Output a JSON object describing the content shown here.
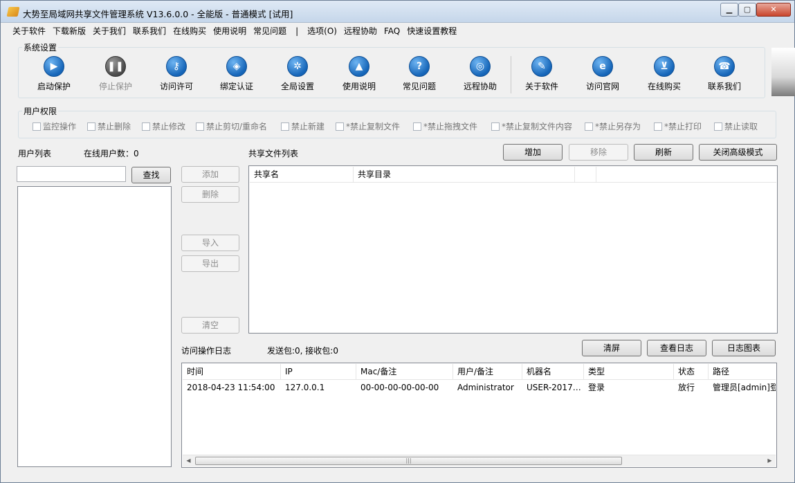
{
  "window": {
    "title": "大势至局域网共享文件管理系统 V13.6.0.0 - 全能版 - 普通模式 [试用]"
  },
  "menu": [
    "关于软件",
    "下载新版",
    "关于我们",
    "联系我们",
    "在线购买",
    "使用说明",
    "常见问题",
    "|",
    "选项(O)",
    "远程协助",
    "FAQ",
    "快速设置教程"
  ],
  "system_settings": {
    "label": "系统设置",
    "tools": [
      {
        "label": "启动保护",
        "icon": "play-icon",
        "enabled": true
      },
      {
        "label": "停止保护",
        "icon": "pause-icon",
        "enabled": false
      },
      {
        "label": "访问许可",
        "icon": "key-icon",
        "enabled": true
      },
      {
        "label": "绑定认证",
        "icon": "shield-icon",
        "enabled": true
      },
      {
        "label": "全局设置",
        "icon": "gear-icon",
        "enabled": true
      },
      {
        "label": "使用说明",
        "icon": "graduation-cap-icon",
        "enabled": true
      },
      {
        "label": "常见问题",
        "icon": "question-icon",
        "enabled": true
      },
      {
        "label": "远程协助",
        "icon": "globe-hand-icon",
        "enabled": true
      },
      {
        "label": "关于软件",
        "icon": "document-pen-icon",
        "enabled": true
      },
      {
        "label": "访问官网",
        "icon": "browser-icon",
        "enabled": true
      },
      {
        "label": "在线购买",
        "icon": "cart-icon",
        "enabled": true
      },
      {
        "label": "联系我们",
        "icon": "phone-icon",
        "enabled": true
      }
    ]
  },
  "permissions": {
    "label": "用户权限",
    "items": [
      "监控操作",
      "禁止删除",
      "禁止修改",
      "禁止剪切/重命名",
      "禁止新建",
      "*禁止复制文件",
      "*禁止拖拽文件",
      "*禁止复制文件内容",
      "*禁止另存为",
      "*禁止打印",
      "禁止读取"
    ]
  },
  "user_list": {
    "label": "用户列表",
    "online_label": "在线用户数：0",
    "search_value": "",
    "find_button": "查找",
    "buttons": {
      "add": "添加",
      "delete": "删除",
      "import": "导入",
      "export": "导出",
      "clear": "清空"
    }
  },
  "shared_files": {
    "label": "共享文件列表",
    "buttons": {
      "add": "增加",
      "remove": "移除",
      "refresh": "刷新",
      "close_advanced": "关闭高级模式"
    },
    "columns": [
      "共享名",
      "共享目录",
      ""
    ]
  },
  "log": {
    "label": "访问操作日志",
    "stats": "发送包:0, 接收包:0",
    "buttons": {
      "clear": "清屏",
      "view": "查看日志",
      "chart": "日志图表"
    },
    "columns": [
      "时间",
      "IP",
      "Mac/备注",
      "用户/备注",
      "机器名",
      "类型",
      "状态",
      "路径"
    ],
    "rows": [
      [
        "2018-04-23 11:54:00",
        "127.0.0.1",
        "00-00-00-00-00-00",
        "Administrator",
        "USER-2017…",
        "登录",
        "放行",
        "管理员[admin]登录"
      ]
    ]
  }
}
